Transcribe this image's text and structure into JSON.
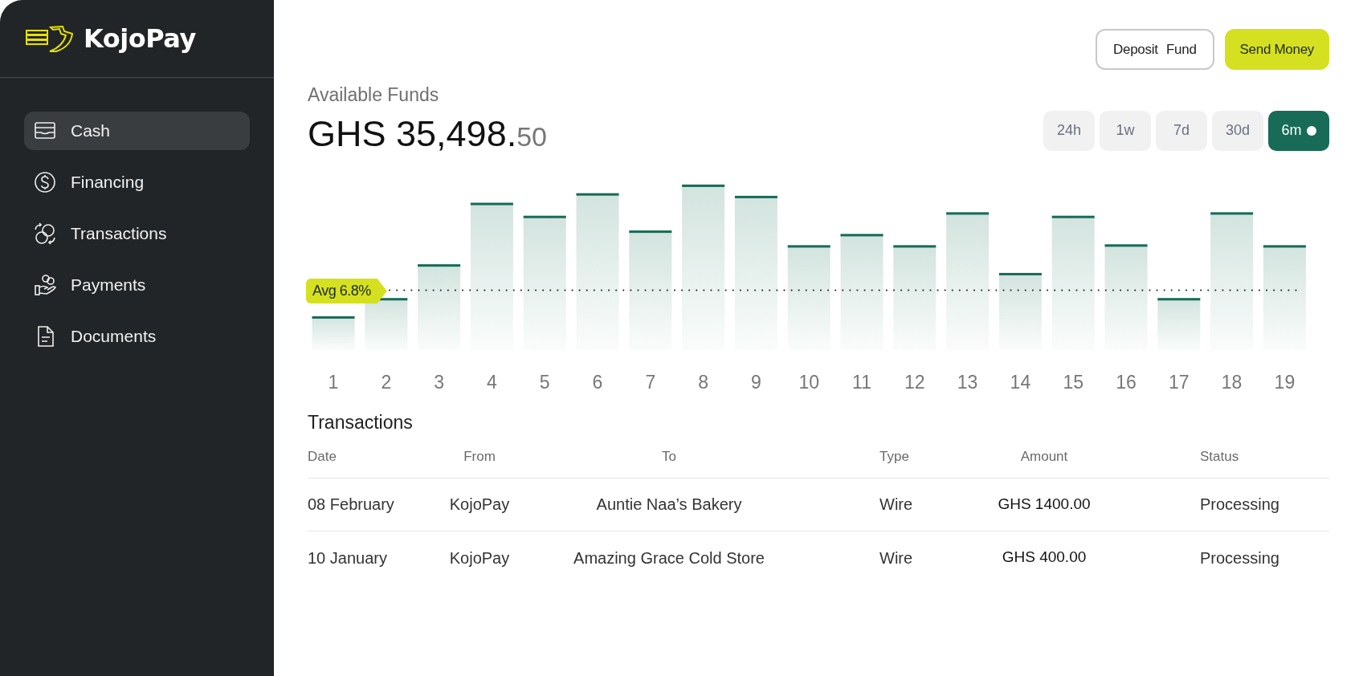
{
  "sidebar": {
    "brand": "KojoPay",
    "items": [
      {
        "label": "Cash",
        "selected": true
      },
      {
        "label": "Financing",
        "selected": false
      },
      {
        "label": "Transactions",
        "selected": false
      },
      {
        "label": "Payments",
        "selected": false
      },
      {
        "label": "Documents",
        "selected": false
      }
    ]
  },
  "actions": [
    {
      "label": "Deposit Fund",
      "kind": "outline"
    },
    {
      "label": "Send Money",
      "kind": "primary"
    }
  ],
  "funds": {
    "label": "Available Funds",
    "amount": "GHS 35,498.",
    "cents": "50"
  },
  "ranges": [
    {
      "label": "24h",
      "selected": false
    },
    {
      "label": "1w",
      "selected": false
    },
    {
      "label": "7d",
      "selected": false
    },
    {
      "label": "30d",
      "selected": false
    },
    {
      "label": "6m",
      "selected": true
    }
  ],
  "chart": {
    "average_label": "Avg 6.8%",
    "x_labels": [
      "1",
      "2",
      "3",
      "4",
      "5",
      "6",
      "7",
      "8",
      "9",
      "10",
      "11",
      "12",
      "13",
      "14",
      "15",
      "16",
      "17",
      "18",
      "19"
    ]
  },
  "transactions": {
    "title": "Transactions",
    "columns": [
      "Date",
      "From",
      "To",
      "Type",
      "Amount",
      "Status"
    ],
    "rows": [
      [
        "08 February",
        "KojoPay",
        "Auntie Naa’s Bakery",
        "Wire",
        "GHS 1400.00",
        "Processing"
      ],
      [
        "10 January",
        "KojoPay",
        "Amazing Grace Cold Store",
        "Wire",
        "GHS 400.00",
        "Processing"
      ]
    ]
  }
}
